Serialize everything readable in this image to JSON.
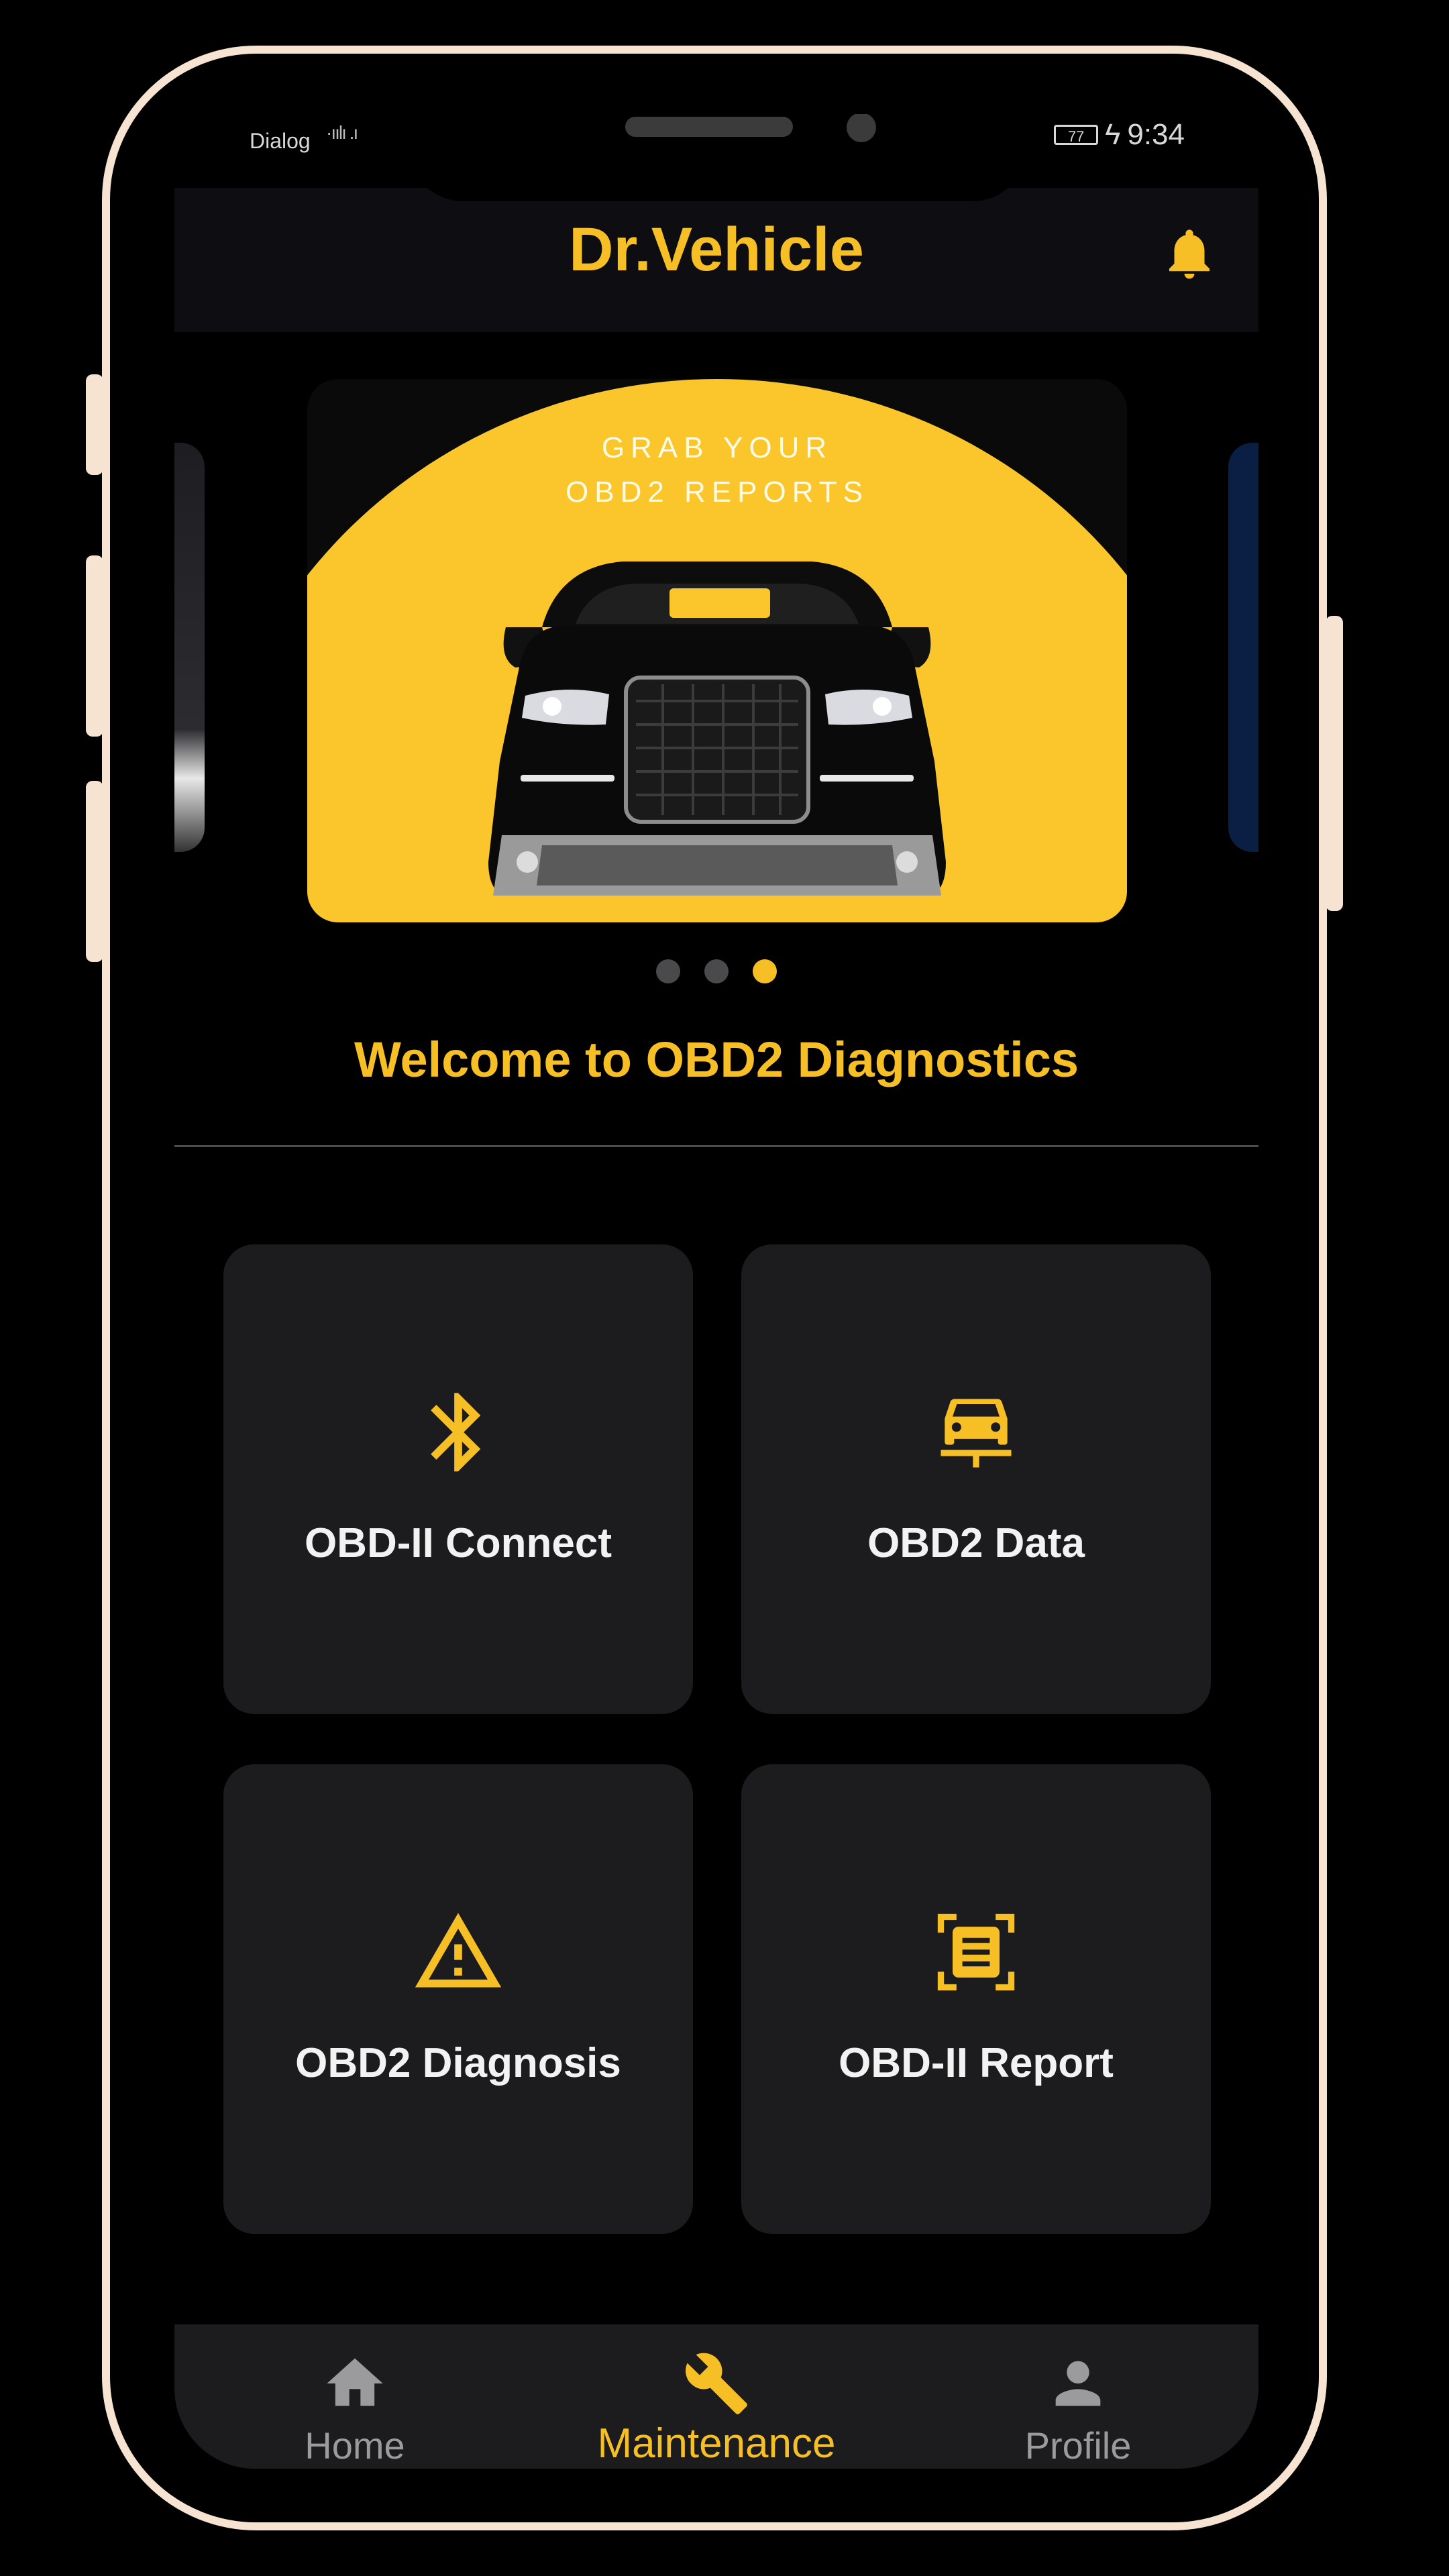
{
  "status_bar": {
    "carrier": "Dialog",
    "signal": "·ıılı .ı",
    "battery": "77",
    "charging_glyph": "ϟ",
    "time": "9:34"
  },
  "header": {
    "title": "Dr.Vehicle",
    "bell_icon": "bell-icon"
  },
  "carousel": {
    "banner_line1": "GRAB YOUR",
    "banner_line2": "OBD2 REPORTS",
    "slide_count": 3,
    "active_index": 2
  },
  "welcome_text": "Welcome to OBD2 Diagnostics",
  "menu": [
    {
      "label": "OBD-II Connect",
      "icon": "bluetooth-icon"
    },
    {
      "label": "OBD2 Data",
      "icon": "car-data-icon"
    },
    {
      "label": "OBD2 Diagnosis",
      "icon": "warning-icon"
    },
    {
      "label": "OBD-II Report",
      "icon": "report-scan-icon"
    }
  ],
  "bottom_nav": [
    {
      "label": "Home",
      "icon": "home-icon",
      "active": false
    },
    {
      "label": "Maintenance",
      "icon": "wrench-icon",
      "active": true
    },
    {
      "label": "Profile",
      "icon": "person-icon",
      "active": false
    }
  ],
  "colors": {
    "accent": "#f7bf26",
    "background": "#000000",
    "card": "#1c1c1e",
    "frame": "#f6e3d1",
    "inactive": "#9b9b9d"
  }
}
